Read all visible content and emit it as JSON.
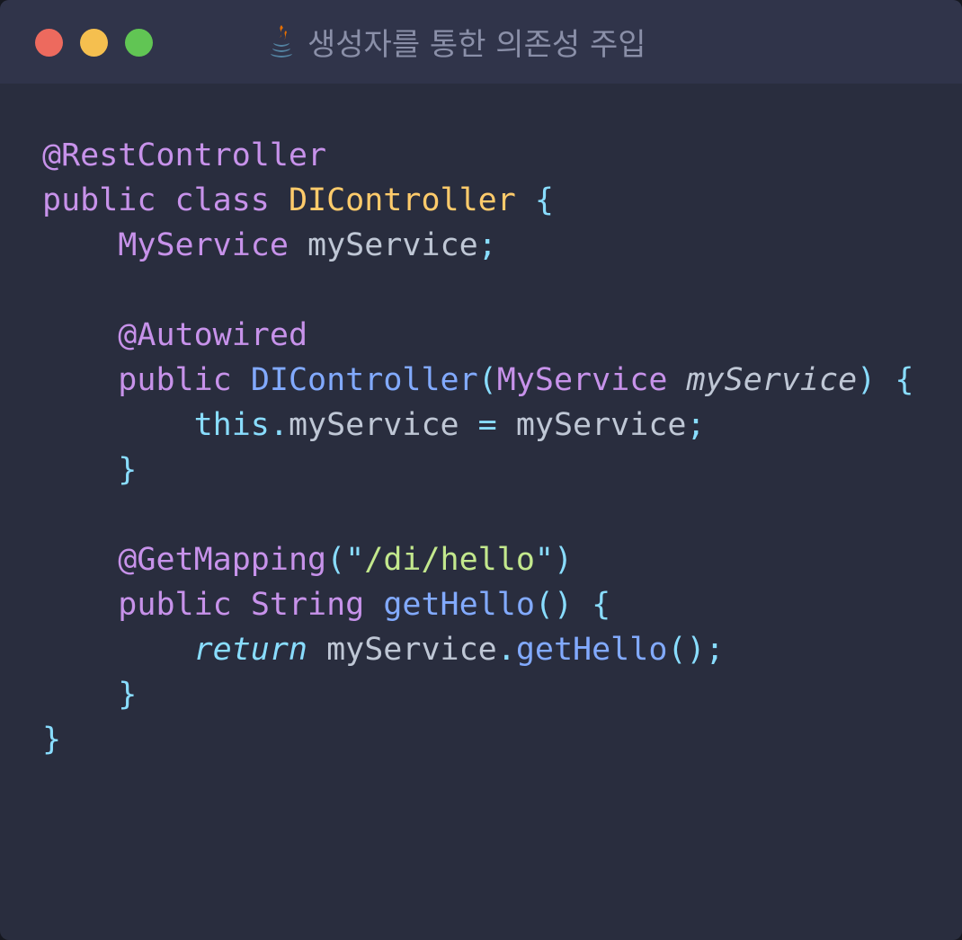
{
  "window": {
    "title": "생성자를 통한 의존성 주입",
    "title_icon": "java-coffee-icon"
  },
  "colors": {
    "background": "#292d3e",
    "titlebar": "#30344a",
    "close": "#ed6a5e",
    "minimize": "#f5bf4f",
    "maximize": "#61c554",
    "annotation": "#c792ea",
    "keyword": "#c792ea",
    "class_name": "#ffcb6b",
    "function": "#82aaff",
    "punctuation": "#89ddff",
    "string": "#c3e88d",
    "plain": "#bfc7d5"
  },
  "code": {
    "language": "java",
    "lines": [
      [
        {
          "t": "ann",
          "v": "@RestController"
        }
      ],
      [
        {
          "t": "kw",
          "v": "public"
        },
        {
          "t": "var",
          "v": " "
        },
        {
          "t": "kw",
          "v": "class"
        },
        {
          "t": "var",
          "v": " "
        },
        {
          "t": "cls",
          "v": "DIController"
        },
        {
          "t": "var",
          "v": " "
        },
        {
          "t": "punc",
          "v": "{"
        }
      ],
      [
        {
          "t": "var",
          "v": "    "
        },
        {
          "t": "type",
          "v": "MyService"
        },
        {
          "t": "var",
          "v": " myService"
        },
        {
          "t": "punc",
          "v": ";"
        }
      ],
      [],
      [
        {
          "t": "var",
          "v": "    "
        },
        {
          "t": "ann",
          "v": "@Autowired"
        }
      ],
      [
        {
          "t": "var",
          "v": "    "
        },
        {
          "t": "kw",
          "v": "public"
        },
        {
          "t": "var",
          "v": " "
        },
        {
          "t": "ctor",
          "v": "DIController"
        },
        {
          "t": "punc",
          "v": "("
        },
        {
          "t": "type",
          "v": "MyService"
        },
        {
          "t": "var",
          "v": " "
        },
        {
          "t": "param",
          "v": "myService"
        },
        {
          "t": "punc",
          "v": ")"
        },
        {
          "t": "var",
          "v": " "
        },
        {
          "t": "punc",
          "v": "{"
        }
      ],
      [
        {
          "t": "var",
          "v": "        "
        },
        {
          "t": "this",
          "v": "this"
        },
        {
          "t": "punc",
          "v": "."
        },
        {
          "t": "var",
          "v": "myService "
        },
        {
          "t": "punc",
          "v": "="
        },
        {
          "t": "var",
          "v": " myService"
        },
        {
          "t": "punc",
          "v": ";"
        }
      ],
      [
        {
          "t": "var",
          "v": "    "
        },
        {
          "t": "punc",
          "v": "}"
        }
      ],
      [],
      [
        {
          "t": "var",
          "v": "    "
        },
        {
          "t": "ann",
          "v": "@GetMapping"
        },
        {
          "t": "punc",
          "v": "(\""
        },
        {
          "t": "str",
          "v": "/di/hello"
        },
        {
          "t": "punc",
          "v": "\")"
        }
      ],
      [
        {
          "t": "var",
          "v": "    "
        },
        {
          "t": "kw",
          "v": "public"
        },
        {
          "t": "var",
          "v": " "
        },
        {
          "t": "type",
          "v": "String"
        },
        {
          "t": "var",
          "v": " "
        },
        {
          "t": "fn",
          "v": "getHello"
        },
        {
          "t": "punc",
          "v": "()"
        },
        {
          "t": "var",
          "v": " "
        },
        {
          "t": "punc",
          "v": "{"
        }
      ],
      [
        {
          "t": "var",
          "v": "        "
        },
        {
          "t": "ret",
          "v": "return"
        },
        {
          "t": "var",
          "v": " myService"
        },
        {
          "t": "punc",
          "v": "."
        },
        {
          "t": "fn",
          "v": "getHello"
        },
        {
          "t": "punc",
          "v": "();"
        }
      ],
      [
        {
          "t": "var",
          "v": "    "
        },
        {
          "t": "punc",
          "v": "}"
        }
      ],
      [
        {
          "t": "punc",
          "v": "}"
        }
      ]
    ]
  }
}
